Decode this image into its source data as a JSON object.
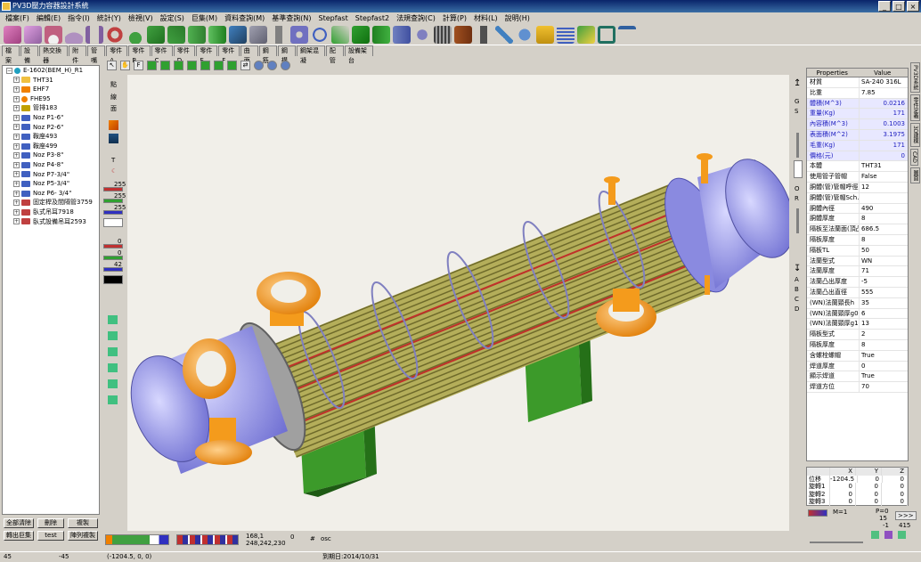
{
  "window": {
    "title": "PV3D壓力容器設計系統",
    "minimize": "_",
    "maximize": "□",
    "close": "×"
  },
  "menu": [
    "檔案(F)",
    "編輯(E)",
    "指令(I)",
    "統計(Y)",
    "檢視(V)",
    "設定(S)",
    "巨集(M)",
    "資料查詢(M)",
    "基準查詢(N)",
    "Stepfast",
    "Stepfast2",
    "法規查詢(C)",
    "計算(P)",
    "材料(L)",
    "說明(H)"
  ],
  "tabs": [
    "檔案",
    "設備",
    "熱交換器",
    "附件",
    "管嘴",
    "零件A",
    "零件B",
    "零件C",
    "零件D",
    "零件E",
    "零件F",
    "曲面",
    "鋼筋",
    "鋼構",
    "鋼架混凝",
    "配管",
    "設備架台"
  ],
  "tree": [
    {
      "label": "E-1602(BEM_H)_R1",
      "color": "#20a0c0"
    },
    {
      "label": "THT31",
      "color": "#f0c040"
    },
    {
      "label": "EHF7",
      "color": "#f08000"
    },
    {
      "label": "FHE95",
      "color": "#f08000"
    },
    {
      "label": "管排183",
      "color": "#c0a000"
    },
    {
      "label": "Noz P1-6\"",
      "color": "#4060c0"
    },
    {
      "label": "Noz P2-6\"",
      "color": "#4060c0"
    },
    {
      "label": "鞍座493",
      "color": "#4060c0"
    },
    {
      "label": "鞍座499",
      "color": "#4060c0"
    },
    {
      "label": "Noz P3-8\"",
      "color": "#4060c0"
    },
    {
      "label": "Noz P4-8\"",
      "color": "#4060c0"
    },
    {
      "label": "Noz P7-3/4\"",
      "color": "#4060c0"
    },
    {
      "label": "Noz P5-3/4\"",
      "color": "#4060c0"
    },
    {
      "label": "Noz P6- 3/4\"",
      "color": "#4060c0"
    },
    {
      "label": "固定桿及間隔管3759",
      "color": "#c04040"
    },
    {
      "label": "臥式吊耳7918",
      "color": "#c04040"
    },
    {
      "label": "臥式設備吊耳2593",
      "color": "#c04040"
    }
  ],
  "bottom_buttons": {
    "clear": "全部清除",
    "delete": "刪除",
    "copy": "複製",
    "to_macro": "轉出巨集",
    "test": "test",
    "array_copy": "陣列複製"
  },
  "left_tools": {
    "point": "點",
    "line": "線",
    "face": "面",
    "t": "T",
    "c255a": "255",
    "c255b": "255",
    "c255c": "255",
    "c0a": "0",
    "c0b": "0",
    "c42": "42"
  },
  "props": {
    "header": {
      "name": "Properties",
      "value": "Value"
    },
    "rows": [
      {
        "k": "材質",
        "v": "SA-240 316L",
        "blue": false
      },
      {
        "k": "比重",
        "v": "7.85",
        "blue": false
      },
      {
        "k": "體積(M^3)",
        "v": "0.0216",
        "blue": true
      },
      {
        "k": "重量(Kg)",
        "v": "171",
        "blue": true
      },
      {
        "k": "內容積(M^3)",
        "v": "0.1003",
        "blue": true
      },
      {
        "k": "表面積(M^2)",
        "v": "3.1975",
        "blue": true
      },
      {
        "k": "毛重(Kg)",
        "v": "171",
        "blue": true
      },
      {
        "k": "價格(元)",
        "v": "0",
        "blue": true
      },
      {
        "k": "本體",
        "v": "THT31",
        "blue": false
      },
      {
        "k": "使用管子管帽",
        "v": "False",
        "blue": false
      },
      {
        "k": "胴體(管)管帽呼徑",
        "v": "12",
        "blue": false
      },
      {
        "k": "胴體(管)管帽Sch.",
        "v": "",
        "blue": false
      },
      {
        "k": "胴體內徑",
        "v": "490",
        "blue": false
      },
      {
        "k": "胴體厚度",
        "v": "8",
        "blue": false
      },
      {
        "k": "隔板至法蘭面(頂凸)",
        "v": "686.5",
        "blue": false
      },
      {
        "k": "隔板厚度",
        "v": "8",
        "blue": false
      },
      {
        "k": "隔板TL",
        "v": "50",
        "blue": false
      },
      {
        "k": "法蘭型式",
        "v": "WN",
        "blue": false
      },
      {
        "k": "法蘭厚度",
        "v": "71",
        "blue": false
      },
      {
        "k": "法蘭凸出厚度",
        "v": "-5",
        "blue": false
      },
      {
        "k": "法蘭凸出直徑",
        "v": "555",
        "blue": false
      },
      {
        "k": "(WN)法蘭頸長h",
        "v": "35",
        "blue": false
      },
      {
        "k": "(WN)法蘭頸厚g0",
        "v": "6",
        "blue": false
      },
      {
        "k": "(WN)法蘭頸厚g1",
        "v": "13",
        "blue": false
      },
      {
        "k": "隔板型式",
        "v": "2",
        "blue": false
      },
      {
        "k": "隔板厚度",
        "v": "8",
        "blue": false
      },
      {
        "k": "含螺栓螺帽",
        "v": "True",
        "blue": false
      },
      {
        "k": "焊道厚度",
        "v": "0",
        "blue": false
      },
      {
        "k": "顯示焊道",
        "v": "True",
        "blue": false
      },
      {
        "k": "焊道方位",
        "v": "70",
        "blue": false
      }
    ]
  },
  "side_tabs": [
    "PV3D系統",
    "零件定義",
    "3D建模",
    "CAD",
    "圖面"
  ],
  "xyz": {
    "header": [
      "",
      "X",
      "Y",
      "Z"
    ],
    "rows": [
      [
        "位移",
        "-1204.5",
        "0",
        "0"
      ],
      [
        "旋轉1",
        "0",
        "0",
        "0"
      ],
      [
        "旋轉2",
        "0",
        "0",
        "0"
      ],
      [
        "旋轉3",
        "0",
        "0",
        "0"
      ]
    ]
  },
  "right_bottom": {
    "m1": "M=1",
    "p0": "P=0",
    "n15": "15",
    "neg1": "-1",
    "n415": "415",
    "go": ">>>"
  },
  "rtool_letters": [
    "G",
    "S",
    "O",
    "R",
    "A",
    "B",
    "C",
    "D"
  ],
  "bottom_strip": {
    "coords1": "168,1",
    "coords2": "248,242,230",
    "hash": "#",
    "osc": "osc",
    "zero": "0"
  },
  "status": {
    "s1": "45",
    "s2": "-45",
    "s3": "(-1204.5, 0, 0)",
    "s4": "到期日:2014/10/31"
  },
  "colors": {
    "shell": "#bdb76b",
    "nozzle": "#f49b1c",
    "head": "#9c9cf0",
    "saddle": "#3c9a2a",
    "stripe": "#c0302a"
  }
}
